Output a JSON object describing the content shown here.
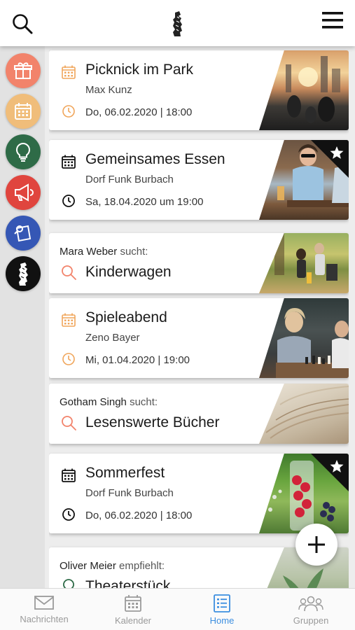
{
  "colors": {
    "accent": "#3b8ee0",
    "gift": "#f2836b",
    "calendar": "#f0bd7a",
    "ideas": "#2e6b47",
    "announce": "#e0453e",
    "search": "#3557b5",
    "dorf": "#111111",
    "orange_icon": "#f0a55a"
  },
  "header": {
    "search_icon": "search-icon",
    "logo": "village-logo",
    "menu_icon": "hamburger-menu-icon"
  },
  "sidebar": {
    "items": [
      {
        "icon": "gift-icon"
      },
      {
        "icon": "calendar-icon"
      },
      {
        "icon": "lightbulb-icon"
      },
      {
        "icon": "megaphone-icon"
      },
      {
        "icon": "search-note-icon"
      },
      {
        "icon": "dorf-funk-logo"
      }
    ]
  },
  "feed": {
    "cards": [
      {
        "title": "Picknick im Park",
        "organizer": "Max Kunz",
        "date": "Do, 06.02.2020 | 18:00"
      },
      {
        "title": "Gemeinsames Essen",
        "organizer": "Dorf Funk Burbach",
        "date": "Sa, 18.04.2020 um 19:00"
      },
      {
        "person": "Mara Weber",
        "verb": "sucht:",
        "title": "Kinderwagen"
      },
      {
        "title": "Spieleabend",
        "organizer": "Zeno Bayer",
        "date": "Mi, 01.04.2020 | 19:00"
      },
      {
        "person": "Gotham Singh",
        "verb": "sucht:",
        "title": "Lesenswerte Bücher"
      },
      {
        "title": "Sommerfest",
        "organizer": "Dorf Funk Burbach",
        "date": "Do, 06.02.2020 | 18:00"
      },
      {
        "person": "Oliver Meier",
        "verb": "empfiehlt:",
        "title": "Theaterstück"
      }
    ]
  },
  "bottom_nav": {
    "items": [
      {
        "label": "Nachrichten"
      },
      {
        "label": "Kalender"
      },
      {
        "label": "Home"
      },
      {
        "label": "Gruppen"
      }
    ],
    "active": "Home"
  }
}
